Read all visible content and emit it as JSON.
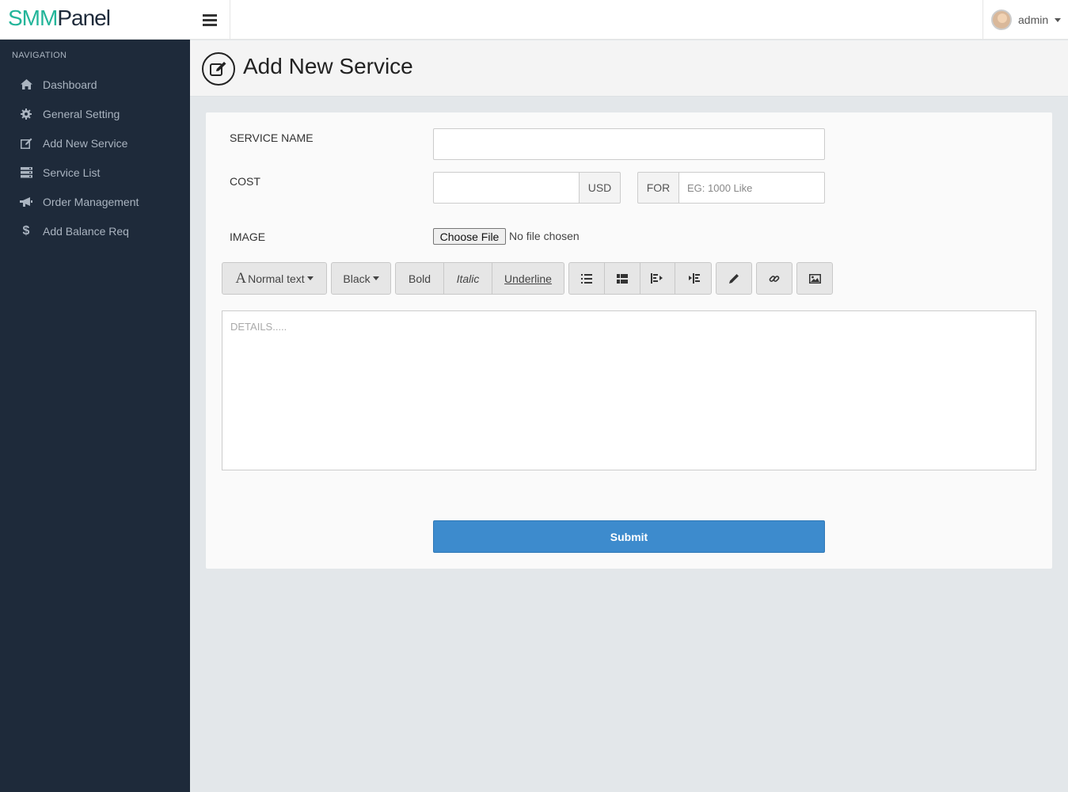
{
  "brand": {
    "part1": "SMM",
    "part2": "Panel"
  },
  "topbar": {
    "user_name": "admin"
  },
  "sidebar": {
    "title": "NAVIGATION",
    "items": [
      {
        "label": "Dashboard",
        "icon": "home-icon"
      },
      {
        "label": "General Setting",
        "icon": "gear-icon"
      },
      {
        "label": "Add New Service",
        "icon": "edit-icon"
      },
      {
        "label": "Service List",
        "icon": "server-icon"
      },
      {
        "label": "Order Management",
        "icon": "megaphone-icon"
      },
      {
        "label": "Add Balance Req",
        "icon": "dollar-icon"
      }
    ]
  },
  "page": {
    "title": "Add New Service"
  },
  "form": {
    "service_name_label": "SERVICE NAME",
    "service_name_value": "",
    "cost_label": "COST",
    "cost_value": "",
    "currency": "USD",
    "for_label": "FOR",
    "for_placeholder": "EG: 1000 Like",
    "image_label": "IMAGE",
    "file_button": "Choose File",
    "file_status": "No file chosen",
    "details_placeholder": "DETAILS.....",
    "submit_label": "Submit"
  },
  "toolbar": {
    "font_size": "Normal text",
    "font_glyph": "A",
    "color": "Black",
    "bold": "Bold",
    "italic": "Italic",
    "underline": "Underline"
  },
  "colors": {
    "sidebar_bg": "#1e2a3a",
    "brand_accent": "#23b59a",
    "submit_bg": "#3d8bcd"
  }
}
